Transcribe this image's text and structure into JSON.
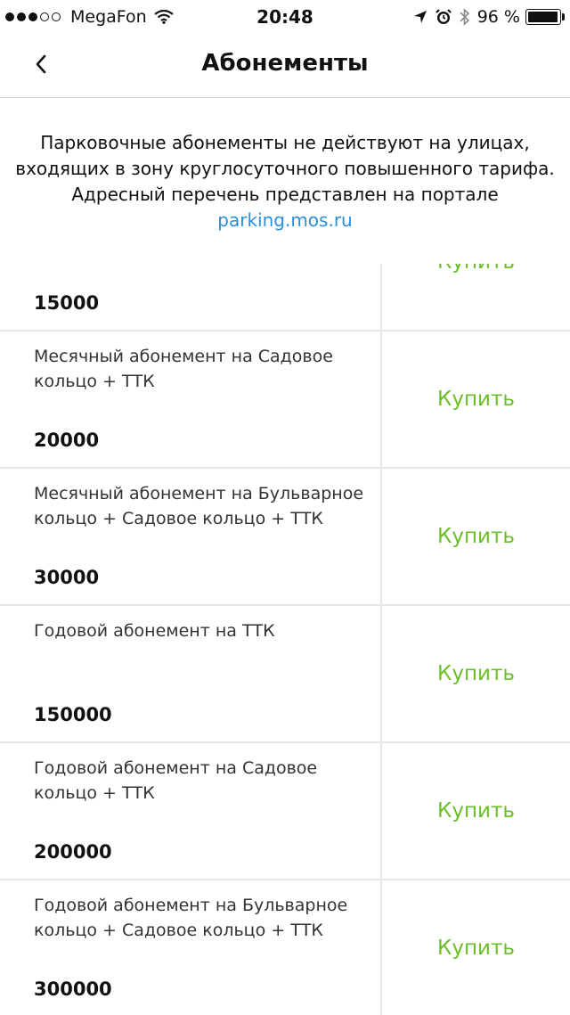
{
  "status_bar": {
    "carrier": "MegaFon",
    "time": "20:48",
    "battery": "96 %",
    "battery_level": 0.96
  },
  "header": {
    "title": "Абонементы"
  },
  "notice": {
    "text": "Парковочные абонементы не действуют на улицах, входящих в зону круглосуточного повышенного тарифа. Адресный перечень представлен на портале",
    "link": "parking.mos.ru"
  },
  "subscriptions": [
    {
      "title": "",
      "price": "15000",
      "button": "Купить"
    },
    {
      "title": "Месячный абонемент на Садовое кольцо + ТТК",
      "price": "20000",
      "button": "Купить"
    },
    {
      "title": "Месячный абонемент на Бульварное кольцо + Садовое кольцо + ТТК",
      "price": "30000",
      "button": "Купить"
    },
    {
      "title": "Годовой абонемент на ТТК",
      "price": "150000",
      "button": "Купить"
    },
    {
      "title": "Годовой абонемент на Садовое кольцо + ТТК",
      "price": "200000",
      "button": "Купить"
    },
    {
      "title": "Годовой абонемент на Бульварное кольцо + Садовое кольцо + ТТК",
      "price": "300000",
      "button": "Купить"
    }
  ]
}
